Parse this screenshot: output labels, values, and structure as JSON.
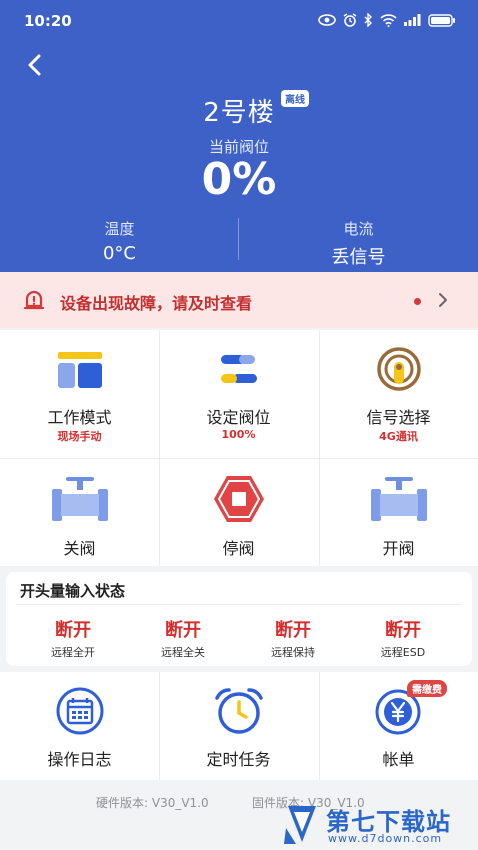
{
  "status_bar": {
    "time": "10:20",
    "icons": [
      "eye-icon",
      "alarm-icon",
      "bluetooth-icon",
      "wifi-icon",
      "signal-icon",
      "battery-icon"
    ]
  },
  "header": {
    "title": "2号楼",
    "offline_badge": "离线",
    "valve_label": "当前阀位",
    "valve_value": "0%",
    "temperature": {
      "label": "温度",
      "value": "0°C"
    },
    "current": {
      "label": "电流",
      "value": "丢信号"
    },
    "color": "#3d61c7"
  },
  "alert": {
    "text": "设备出现故障，请及时查看",
    "color": "#c23030",
    "background": "#fde6e6"
  },
  "controls": [
    {
      "label": "工作模式",
      "sub": "现场手动",
      "icon": "work-mode-icon"
    },
    {
      "label": "设定阀位",
      "sub": "100%",
      "icon": "valve-setting-icon"
    },
    {
      "label": "信号选择",
      "sub": "4G通讯",
      "icon": "signal-select-icon"
    },
    {
      "label": "关阀",
      "sub": "",
      "icon": "valve-close-icon"
    },
    {
      "label": "停阀",
      "sub": "",
      "icon": "valve-stop-icon"
    },
    {
      "label": "开阀",
      "sub": "",
      "icon": "valve-open-icon"
    }
  ],
  "switch_status": {
    "title": "开头量输入状态",
    "items": [
      {
        "state": "断开",
        "name": "远程全开"
      },
      {
        "state": "断开",
        "name": "远程全关"
      },
      {
        "state": "断开",
        "name": "远程保持"
      },
      {
        "state": "断开",
        "name": "远程ESD"
      }
    ]
  },
  "bottom_actions": [
    {
      "label": "操作日志",
      "icon": "calendar-log-icon",
      "badge": ""
    },
    {
      "label": "定时任务",
      "icon": "alarm-clock-icon",
      "badge": ""
    },
    {
      "label": "帐单",
      "icon": "yen-bill-icon",
      "badge": "需缴费"
    }
  ],
  "footer": {
    "hardware_version": "硬件版本: V30_V1.0",
    "firmware_version": "固件版本: V30_V1.0"
  },
  "watermark": {
    "name": "第七下载站",
    "url": "www.d7down.com"
  },
  "colors": {
    "accent": "#3d61c7",
    "danger": "#d32f2f",
    "icon_blue": "#2f5fd6",
    "icon_light_blue": "#8aa7ec",
    "icon_yellow": "#f5c518",
    "icon_brown": "#9a6b3a"
  }
}
